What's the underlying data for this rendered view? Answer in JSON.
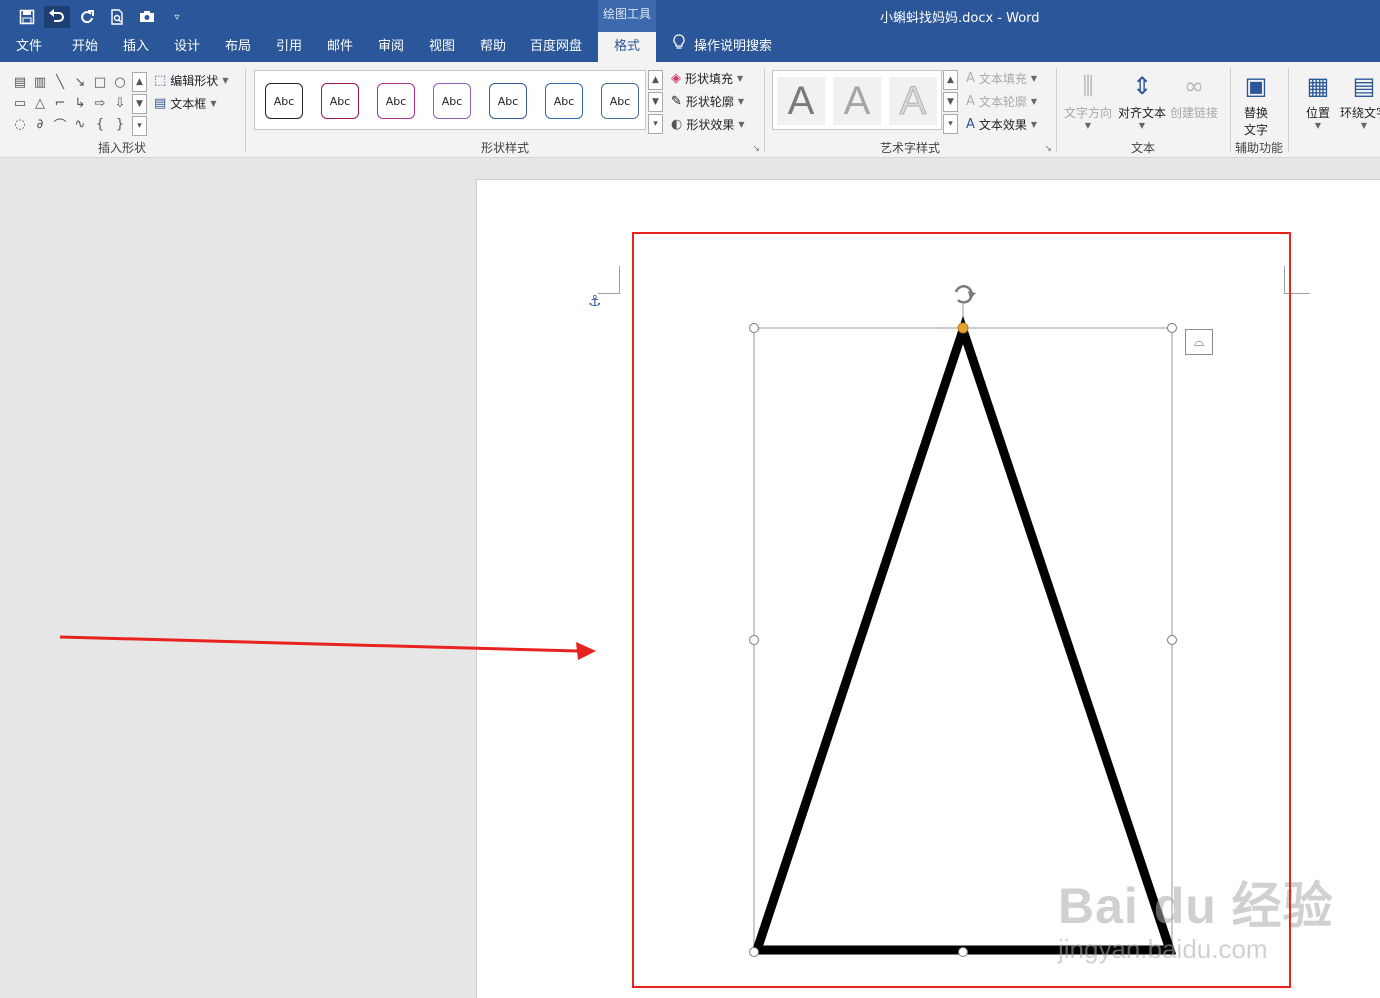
{
  "title_bar": {
    "context_group": "绘图工具",
    "doc_title": "小蝌蚪找妈妈.docx  -  Word"
  },
  "quick_access": {
    "save_icon": "save-icon",
    "undo_icon": "undo-icon",
    "redo_icon": "redo-icon",
    "print_preview_icon": "print-preview-icon",
    "touch_mode_icon": "touch-mode-icon",
    "customize_icon": "chevron-down-icon"
  },
  "tabs": [
    "文件",
    "开始",
    "插入",
    "设计",
    "布局",
    "引用",
    "邮件",
    "审阅",
    "视图",
    "帮助",
    "百度网盘",
    "格式"
  ],
  "active_tab": "格式",
  "tell_me": "操作说明搜索",
  "ribbon": {
    "insert_shapes": {
      "label": "插入形状",
      "edit_shape": "编辑形状",
      "text_box": "文本框"
    },
    "shape_styles": {
      "label": "形状样式",
      "items": [
        "Abc",
        "Abc",
        "Abc",
        "Abc",
        "Abc",
        "Abc",
        "Abc"
      ],
      "item_colors": [
        "#222222",
        "#a31747",
        "#b0318e",
        "#8f5fbf",
        "#3a5a9a",
        "#2f6db3",
        "#4a6f9a"
      ],
      "fill": "形状填充",
      "outline": "形状轮廓",
      "effects": "形状效果"
    },
    "wordart_styles": {
      "label": "艺术字样式",
      "items": [
        "A",
        "A",
        "A"
      ],
      "text_fill": "文本填充",
      "text_outline": "文本轮廓",
      "text_effects": "文本效果"
    },
    "text": {
      "label": "文本",
      "direction": "文字方向",
      "align": "对齐文本",
      "create_link": "创建链接"
    },
    "accessibility": {
      "label": "辅助功能",
      "alt_text_line1": "替换",
      "alt_text_line2": "文字"
    },
    "arrange": {
      "position": "位置",
      "wrap_text": "环绕文字"
    }
  },
  "watermark": {
    "main": "Bai du 经验",
    "sub": "jingyan.baidu.com"
  },
  "colors": {
    "accent": "#2b579a",
    "highlight_box": "#e8231f",
    "adjust_handle": "#e0a32e"
  }
}
